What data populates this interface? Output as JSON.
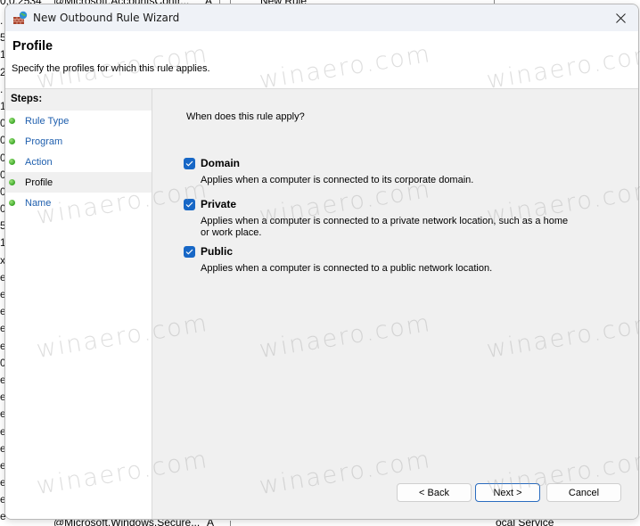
{
  "background": {
    "top_fragments": [
      "0,0.2534",
      "@Microsoft.AccountsContr...",
      "A",
      "New Rule"
    ],
    "bottom_fragments": [
      "@Microsoft.Windows.Secure...",
      "A",
      "ocal Service"
    ],
    "left_column_chars": [
      ".",
      "5",
      "1",
      "2",
      ".",
      "1",
      "0",
      "0",
      "0",
      "0",
      "0",
      "0",
      "5",
      "1",
      "x",
      "e",
      "e",
      "e",
      "e",
      "e",
      "0",
      "e",
      "e",
      "e",
      "e",
      "e",
      "e",
      "e",
      "e",
      "e"
    ]
  },
  "dialog": {
    "title": "New Outbound Rule Wizard",
    "close_label": "✕",
    "header": {
      "title": "Profile",
      "subtitle": "Specify the profiles for which this rule applies."
    },
    "steps": {
      "header": "Steps:",
      "items": [
        {
          "label": "Rule Type",
          "current": false
        },
        {
          "label": "Program",
          "current": false
        },
        {
          "label": "Action",
          "current": false
        },
        {
          "label": "Profile",
          "current": true
        },
        {
          "label": "Name",
          "current": false
        }
      ]
    },
    "content": {
      "question": "When does this rule apply?",
      "options": [
        {
          "label": "Domain",
          "checked": true,
          "description": "Applies when a computer is connected to its corporate domain."
        },
        {
          "label": "Private",
          "checked": true,
          "description": "Applies when a computer is connected to a private network location, such as a home or work place."
        },
        {
          "label": "Public",
          "checked": true,
          "description": "Applies when a computer is connected to a public network location."
        }
      ]
    },
    "buttons": {
      "back": "< Back",
      "next": "Next >",
      "cancel": "Cancel"
    }
  },
  "watermark": "winaero.com",
  "colors": {
    "accent": "#1767c6",
    "step_link": "#1f5fae",
    "step_dot": "#3aa526",
    "titlebar": "#eff2f7",
    "panel": "#f0f0f0"
  }
}
